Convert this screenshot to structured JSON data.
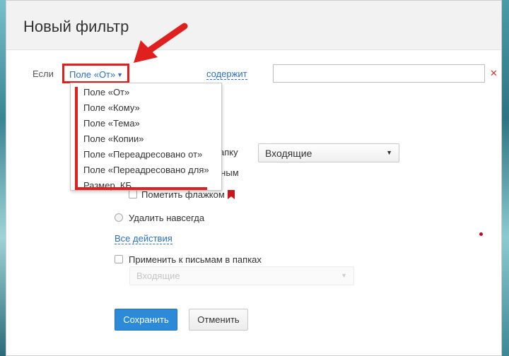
{
  "dialog": {
    "title": "Новый фильтр"
  },
  "condition": {
    "if_label": "Если",
    "field_selected": "Поле «От»",
    "operator": "содержит",
    "value": "",
    "remove_symbol": "✕"
  },
  "field_options": [
    "Поле «От»",
    "Поле «Кому»",
    "Поле «Тема»",
    "Поле «Копии»",
    "Поле «Переадресовано от»",
    "Поле «Переадресовано для»",
    "Размер, КБ"
  ],
  "actions": {
    "move_to_folder_partial": "апку",
    "folder_selected": "Входящие",
    "mark_read_partial": "нным",
    "mark_flag_label": "Пометить флажком",
    "delete_forever_label": "Удалить навсегда",
    "all_actions_link": "Все действия"
  },
  "apply": {
    "label": "Применить к письмам в папках",
    "folder_selected": "Входящие"
  },
  "buttons": {
    "save": "Сохранить",
    "cancel": "Отменить"
  },
  "icons": {
    "caret": "chevron-down-icon",
    "flag": "flag-icon",
    "remove": "close-icon",
    "arrow": "red-arrow-icon"
  },
  "colors": {
    "accent": "#2d8ad8",
    "link": "#2a70c6",
    "annotation": "#e0201e",
    "flag": "#c8171c"
  }
}
